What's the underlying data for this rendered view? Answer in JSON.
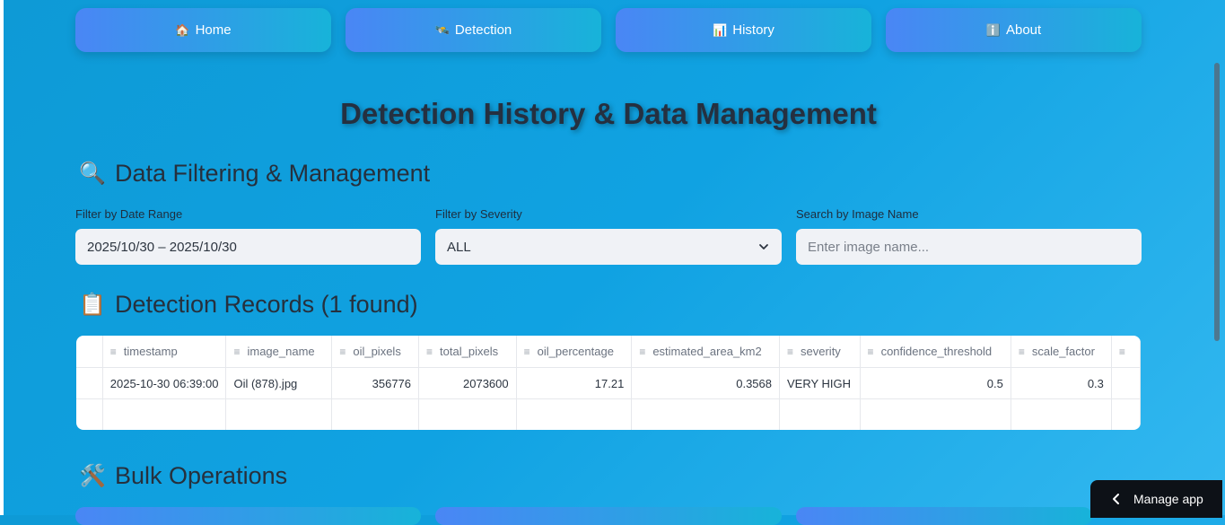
{
  "nav": [
    {
      "icon": "🏠",
      "label": "Home"
    },
    {
      "icon": "🛰️",
      "label": "Detection"
    },
    {
      "icon": "📊",
      "label": "History"
    },
    {
      "icon": "ℹ️",
      "label": "About"
    }
  ],
  "page_title": "Detection History & Data Management",
  "filter_section": {
    "icon": "🔍",
    "title": "Data Filtering & Management",
    "date_label": "Filter by Date Range",
    "date_value": "2025/10/30 – 2025/10/30",
    "severity_label": "Filter by Severity",
    "severity_value": "ALL",
    "search_label": "Search by Image Name",
    "search_placeholder": "Enter image name..."
  },
  "records_section": {
    "icon": "📋",
    "title": "Detection Records (1 found)"
  },
  "table": {
    "columns": [
      "timestamp",
      "image_name",
      "oil_pixels",
      "total_pixels",
      "oil_percentage",
      "estimated_area_km2",
      "severity",
      "confidence_threshold",
      "scale_factor"
    ],
    "rows": [
      [
        "2025-10-30 06:39:00",
        "Oil (878).jpg",
        "356776",
        "2073600",
        "17.21",
        "0.3568",
        "VERY HIGH",
        "0.5",
        "0.3"
      ]
    ]
  },
  "bulk_section": {
    "icon": "🛠️",
    "title": "Bulk Operations"
  },
  "manage_app": "Manage app"
}
